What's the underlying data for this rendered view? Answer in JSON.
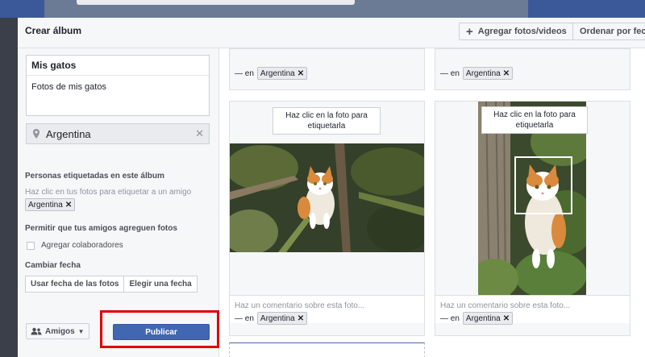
{
  "modal": {
    "title": "Crear álbum",
    "add_button": "Agregar fotos/videos",
    "order_button": "Ordenar por fecha"
  },
  "left_panel": {
    "album_name": "Mis gatos",
    "album_description": "Fotos de mis gatos",
    "location": "Argentina",
    "tagged_label": "Personas etiquetadas en este álbum",
    "tagged_hint": "Haz clic en tus fotos para etiquetar a un amigo",
    "tag_chip": "Argentina",
    "allow_label": "Permitir que tus amigos agreguen fotos",
    "collaborators_label": "Agregar colaboradores",
    "date_label": "Cambiar fecha",
    "date_from_photos": "Usar fecha de las fotos",
    "date_choose": "Elegir una fecha",
    "audience": "Amigos",
    "publish": "Publicar"
  },
  "photos": [
    {
      "tip": "Haz clic en la foto para etiquetarla",
      "comment_placeholder": "Haz un comentario sobre esta foto...",
      "tag_prefix": "— en",
      "tag": "Argentina"
    },
    {
      "tip": "Haz clic en la foto para etiquetarla",
      "comment_placeholder": "Haz un comentario sobre esta foto...",
      "tag_prefix": "— en",
      "tag": "Argentina"
    }
  ],
  "top_cards": [
    {
      "tag_prefix": "— en",
      "tag": "Argentina"
    },
    {
      "tag_prefix": "— en",
      "tag": "Argentina"
    }
  ],
  "colors": {
    "publish": "#4267b2",
    "highlight": "#e00000",
    "header": "#f6f7f9"
  }
}
